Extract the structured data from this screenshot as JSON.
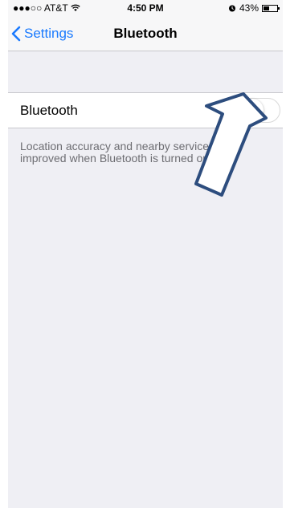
{
  "status_bar": {
    "carrier": "●●●○○ AT&T",
    "wifi_icon": "wifi-icon",
    "time": "4:50 PM",
    "alarm_icon": "alarm-icon",
    "battery": "43%",
    "battery_level": 0.43
  },
  "nav": {
    "back_label": "Settings",
    "title": "Bluetooth"
  },
  "setting": {
    "label": "Bluetooth",
    "enabled": false
  },
  "footer_text": "Location accuracy and nearby services are improved when Bluetooth is turned on.",
  "colors": {
    "accent": "#1a7afe",
    "arrow": "#2d4d7e",
    "background": "#efeff4"
  }
}
